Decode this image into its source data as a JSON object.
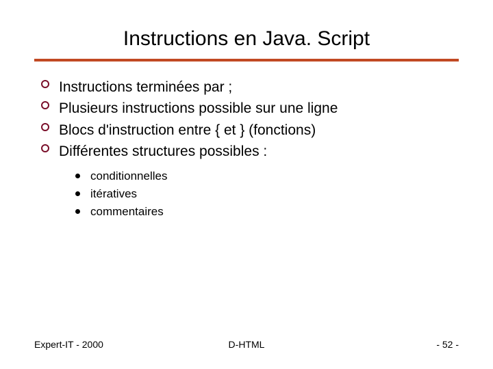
{
  "title": "Instructions en Java. Script",
  "bullets": [
    "Instructions terminées par ;",
    "Plusieurs instructions possible sur une ligne",
    "Blocs d'instruction entre { et } (fonctions)",
    "Différentes structures possibles :"
  ],
  "subbullets": [
    "conditionnelles",
    "itératives",
    "commentaires"
  ],
  "footer": {
    "left": "Expert-IT - 2000",
    "center": "D-HTML",
    "right": "- 52 -"
  }
}
